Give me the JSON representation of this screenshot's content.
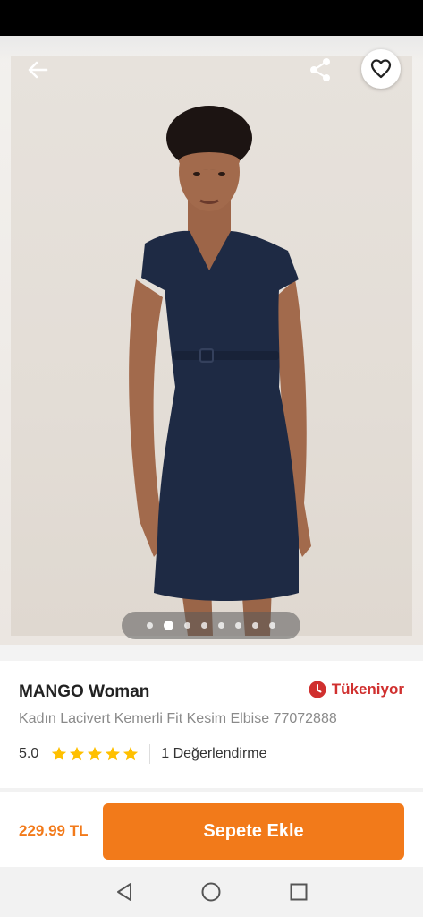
{
  "gallery": {
    "image_count": 8,
    "active_index": 1
  },
  "product": {
    "brand": "MANGO Woman",
    "stock_status": "Tükeniyor",
    "name": "Kadın Lacivert Kemerli Fit Kesim Elbise 77072888",
    "rating": "5.0",
    "stars": 5,
    "review_count": "1 Değerlendirme"
  },
  "buy_bar": {
    "price": "229.99 TL",
    "add_to_cart_label": "Sepete Ekle"
  },
  "colors": {
    "accent": "#f27a1a",
    "stock_alert": "#d0302f",
    "star": "#ffc000"
  },
  "icons": {
    "back": "back-arrow-icon",
    "share": "share-icon",
    "favorite": "heart-icon",
    "stock": "clock-icon",
    "nav_back": "triangle-back-icon",
    "nav_home": "circle-home-icon",
    "nav_recents": "square-recents-icon"
  }
}
